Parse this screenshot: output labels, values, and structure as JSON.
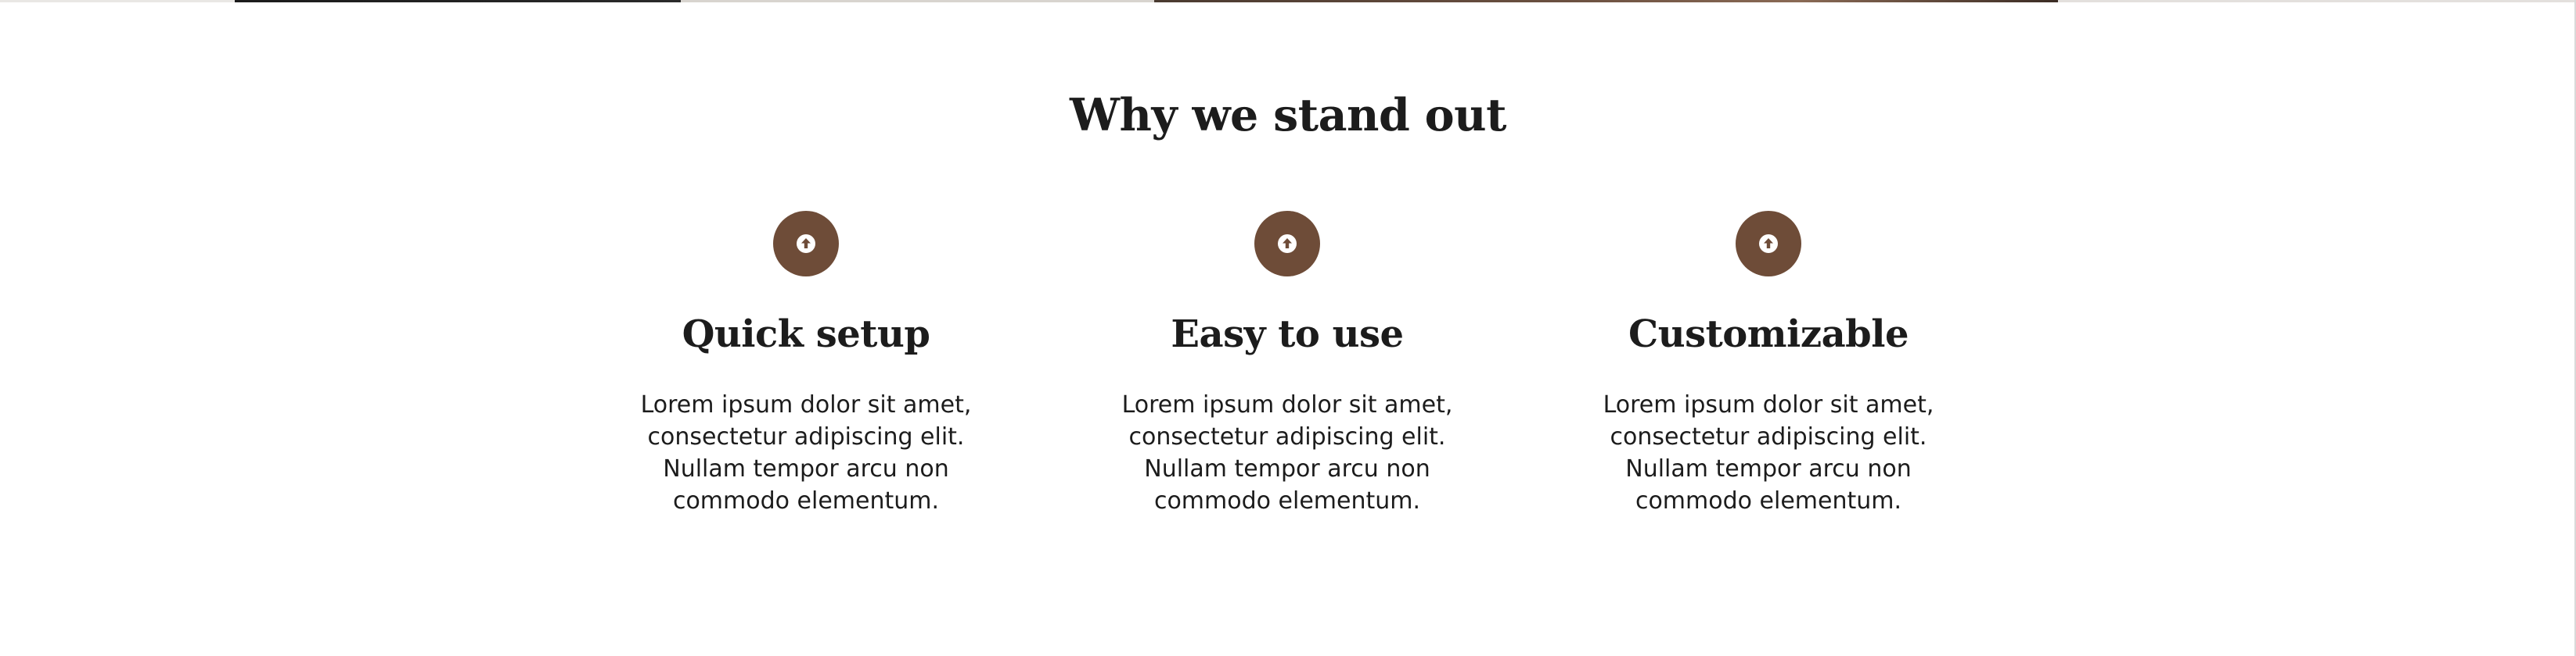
{
  "section": {
    "title": "Why we stand out"
  },
  "features": [
    {
      "icon": "arrow-up-circle-icon",
      "title": "Quick setup",
      "description": "Lorem ipsum dolor sit amet, consectetur adipiscing elit. Nullam tempor arcu non commodo elementum."
    },
    {
      "icon": "arrow-up-circle-icon",
      "title": "Easy to use",
      "description": "Lorem ipsum dolor sit amet, consectetur adipiscing elit. Nullam tempor arcu non commodo elementum."
    },
    {
      "icon": "arrow-up-circle-icon",
      "title": "Customizable",
      "description": "Lorem ipsum dolor sit amet, consectetur adipiscing elit. Nullam tempor arcu non commodo elementum."
    }
  ],
  "colors": {
    "accent": "#6e4c38",
    "text": "#1c1c1c",
    "background": "#ffffff"
  }
}
